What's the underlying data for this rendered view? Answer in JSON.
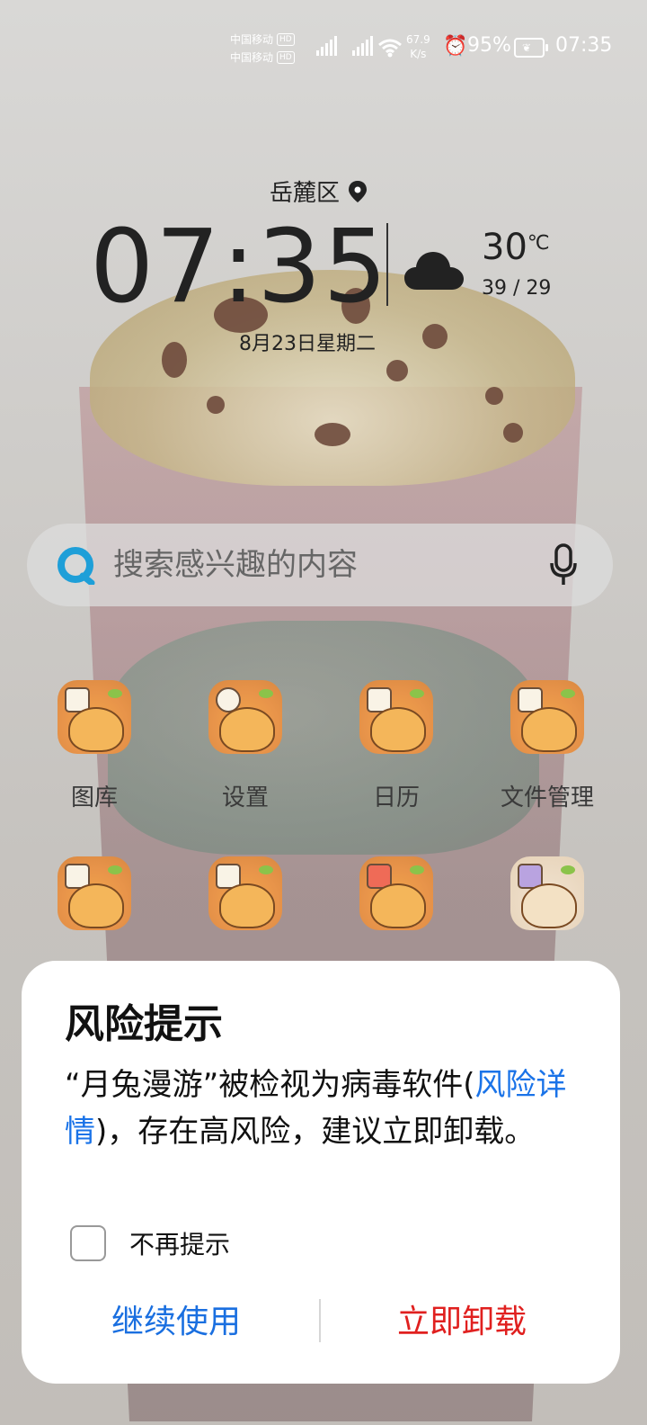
{
  "status_bar": {
    "carrier1": "中国移动",
    "carrier2": "中国移动",
    "hd": "HD",
    "speed_value": "67.9",
    "speed_unit": "K/s",
    "battery_percent": "95%",
    "time": "07:35",
    "icons": [
      "signal-icon",
      "wifi-icon",
      "alarm-icon",
      "battery-icon"
    ]
  },
  "widget": {
    "location": "岳麓区",
    "time": "07:35",
    "temperature": "30",
    "temperature_unit": "℃",
    "temp_range": "39 / 29",
    "date": "8月23日星期二",
    "weather_icon": "cloud-icon"
  },
  "search": {
    "placeholder": "搜索感兴趣的内容"
  },
  "apps": [
    {
      "label": "图库"
    },
    {
      "label": "设置"
    },
    {
      "label": "日历"
    },
    {
      "label": "文件管理"
    },
    {
      "label": ""
    },
    {
      "label": ""
    },
    {
      "label": ""
    },
    {
      "label": ""
    }
  ],
  "dialog": {
    "title": "风险提示",
    "message_part1": "“月兔漫游”被检视为病毒软件(",
    "link": "风险详情",
    "message_part2": ")，存在高风险，建议立即卸载。",
    "checkbox_label": "不再提示",
    "continue_button": "继续使用",
    "uninstall_button": "立即卸载",
    "colors": {
      "continue": "#1a6fe0",
      "uninstall": "#e0201f",
      "link": "#1a73e8"
    }
  }
}
